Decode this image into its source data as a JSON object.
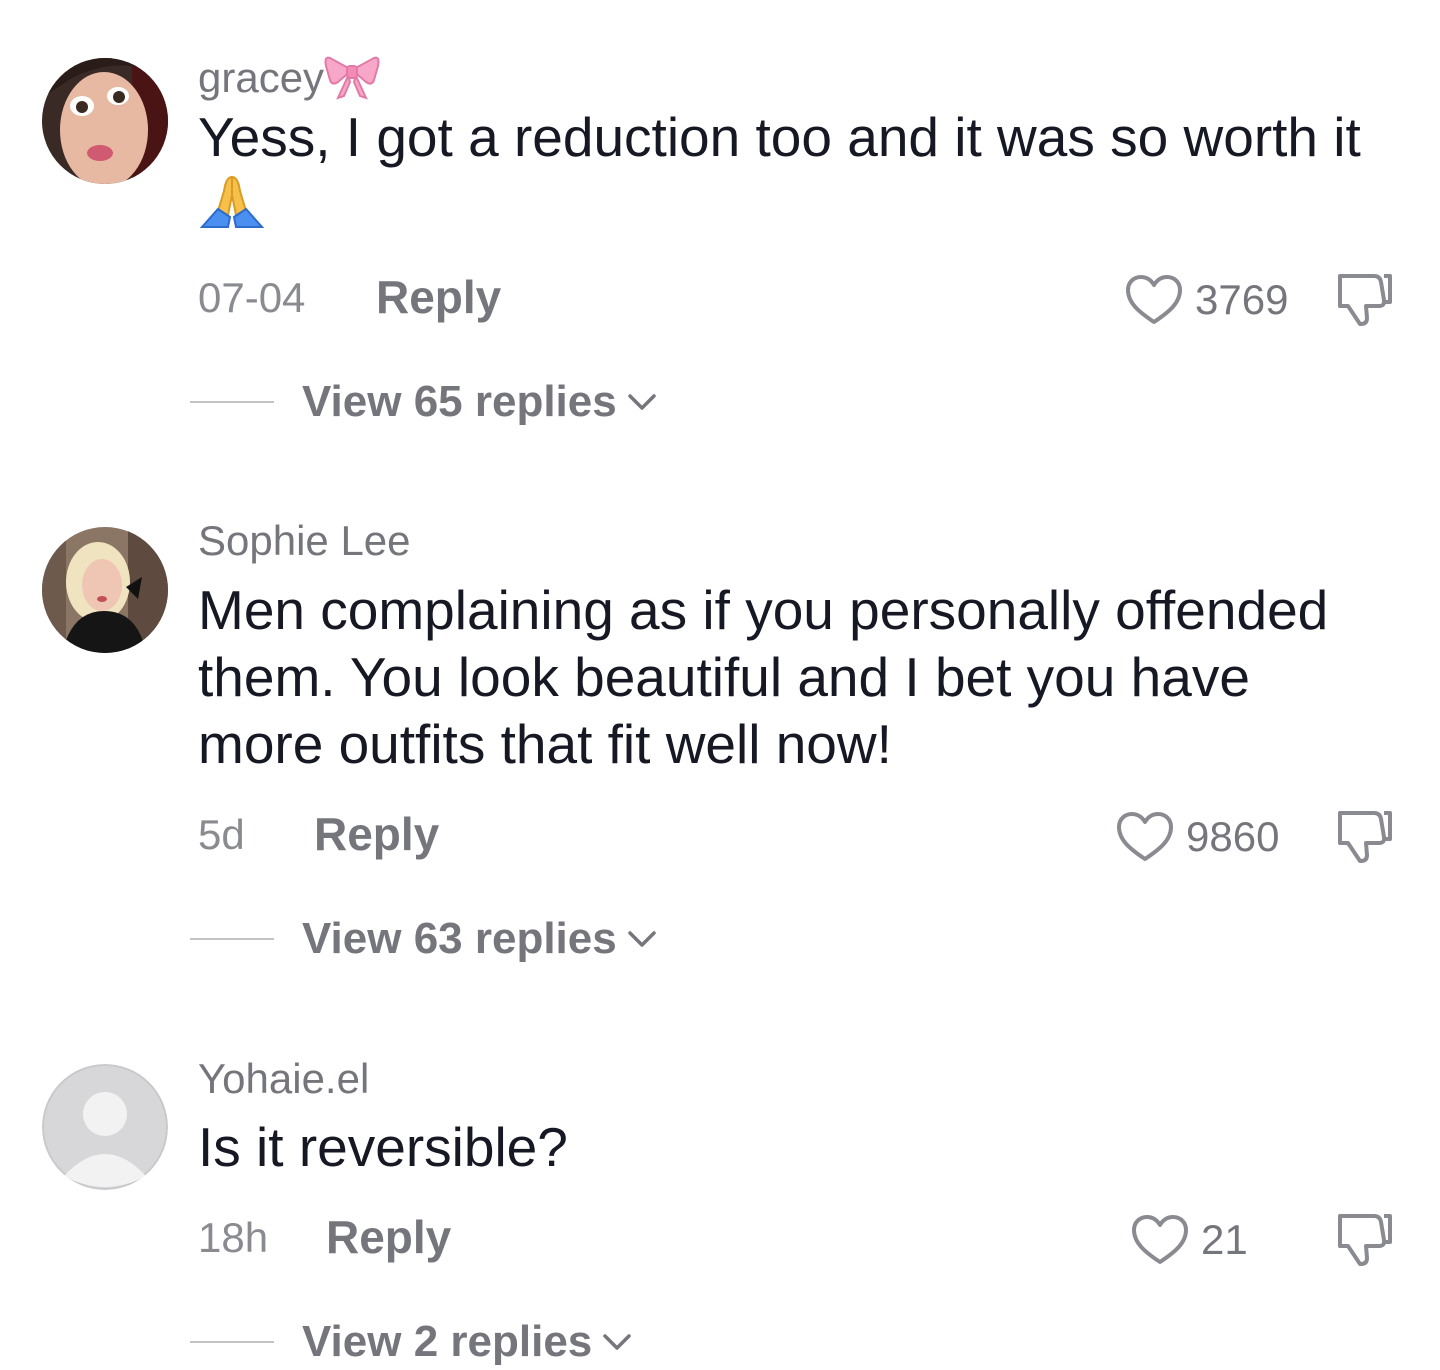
{
  "comments": [
    {
      "username": "gracey",
      "username_emoji": "bow",
      "text": "Yess, I got a reduction too and it was so worth it",
      "text_emoji": "folded-hands",
      "time": "07-04",
      "reply_label": "Reply",
      "likes": "3769",
      "view_replies": "View 65 replies"
    },
    {
      "username": "Sophie Lee",
      "text": "Men complaining as if you personally offended them. You look beautiful and I bet you have more outfits that fit well now!",
      "time": "5d",
      "reply_label": "Reply",
      "likes": "9860",
      "view_replies": "View 63 replies"
    },
    {
      "username": "Yohaie.el",
      "text": "Is it reversible?",
      "time": "18h",
      "reply_label": "Reply",
      "likes": "21",
      "view_replies": "View 2 replies"
    }
  ],
  "colors": {
    "text": "#161823",
    "secondary": "#75767c",
    "divider": "#c4c4c6",
    "default_avatar_bg": "#d7d7d9",
    "default_avatar_fg": "#f2f2f3"
  },
  "icons": [
    "heart-outline-icon",
    "thumbs-down-icon",
    "chevron-down-icon",
    "bow-emoji-icon",
    "folded-hands-emoji-icon",
    "default-avatar-icon"
  ]
}
